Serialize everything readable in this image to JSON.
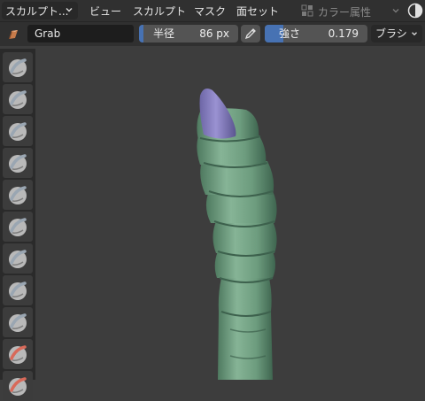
{
  "header": {
    "mode_label": "スカルプト...",
    "menus": [
      "ビュー",
      "スカルプト",
      "マスク",
      "面セット"
    ],
    "color_attribute_label": "カラー属性"
  },
  "tool_settings": {
    "brush_name": "Grab",
    "radius": {
      "label": "半径",
      "value": "86 px",
      "fill_fraction": 0.0
    },
    "strength": {
      "label": "強さ",
      "value": "0.179",
      "fill_fraction": 0.179
    },
    "brush_menu_label": "ブラシ"
  },
  "tools": [
    {
      "name": "draw",
      "color": "#9aa6b2"
    },
    {
      "name": "draw-sharp",
      "color": "#9aa6b2"
    },
    {
      "name": "clay",
      "color": "#9aa6b2"
    },
    {
      "name": "clay-strips",
      "color": "#9aa6b2"
    },
    {
      "name": "clay-thumb",
      "color": "#9aa6b2"
    },
    {
      "name": "layer",
      "color": "#9aa6b2"
    },
    {
      "name": "inflate",
      "color": "#9aa6b2"
    },
    {
      "name": "blob",
      "color": "#9aa6b2"
    },
    {
      "name": "crease",
      "color": "#9aa6b2"
    },
    {
      "name": "smooth",
      "color": "#d86a5a"
    },
    {
      "name": "flatten",
      "color": "#d86a5a"
    }
  ],
  "colors": {
    "accent": "#4772b3",
    "model_body": "#7aa88a",
    "model_tip": "#8a82c4",
    "viewport_bg": "#3d3d3d"
  }
}
